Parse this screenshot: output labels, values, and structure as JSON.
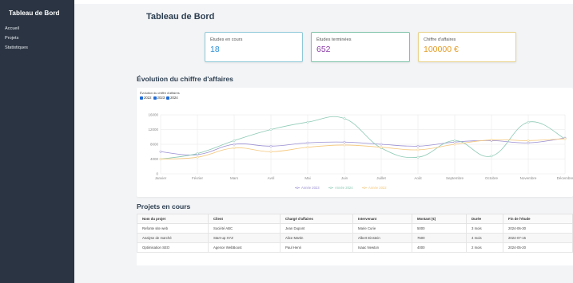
{
  "sidebar": {
    "title": "Tableau de Bord",
    "items": [
      {
        "label": "Accueil"
      },
      {
        "label": "Projets"
      },
      {
        "label": "Statistiques"
      }
    ]
  },
  "header": {
    "title": "Tableau de Bord"
  },
  "stats": [
    {
      "label": "Études en cours",
      "value": "18",
      "color": "#2d8fd5",
      "border": "#8fc9d8"
    },
    {
      "label": "Études terminées",
      "value": "652",
      "color": "#8a3aa6",
      "border": "#7fc2a8"
    },
    {
      "label": "Chiffre d'affaires",
      "value": "100000 €",
      "color": "#e39a1f",
      "border": "#e8d28a"
    }
  ],
  "chart_section": {
    "title": "Évolution du chiffre d'affaires",
    "caption": "Évolution du chiffre d'affaires",
    "toggles": [
      "2022",
      "2023",
      "2024"
    ]
  },
  "chart_data": {
    "type": "line",
    "categories": [
      "Janvier",
      "Février",
      "Mars",
      "Avril",
      "Mai",
      "Juin",
      "Juillet",
      "Août",
      "Septembre",
      "Octobre",
      "Novembre",
      "Décembre"
    ],
    "ylim": [
      0,
      16000
    ],
    "yticks": [
      0,
      4000,
      8000,
      12000,
      16000
    ],
    "grid": true,
    "legend_position": "bottom",
    "series": [
      {
        "name": "Année 2023",
        "color": "#9b8fd3",
        "values": [
          6000,
          5200,
          8000,
          7500,
          8400,
          8600,
          8000,
          7500,
          8600,
          9000,
          8400,
          9700
        ]
      },
      {
        "name": "Année 2024",
        "color": "#8cc9b5",
        "values": [
          4000,
          5500,
          9000,
          12000,
          14000,
          15000,
          7000,
          4500,
          9000,
          4800,
          14000,
          9500
        ]
      },
      {
        "name": "Année 2022",
        "color": "#f4c77a",
        "values": [
          4000,
          4500,
          7000,
          6000,
          7200,
          7800,
          7200,
          6500,
          8000,
          9200,
          9000,
          9500
        ]
      }
    ]
  },
  "projects": {
    "title": "Projets en cours",
    "columns": [
      "Nom du projet",
      "Client",
      "Chargé d'affaires",
      "Intervenant",
      "Montant (€)",
      "Durée",
      "Fin de l'étude"
    ],
    "rows": [
      [
        "Refonte site web",
        "Société ABC",
        "Jean Dupont",
        "Marie Curie",
        "5000",
        "3 mois",
        "2024-06-30"
      ],
      [
        "Analyse de marché",
        "Start-up XYZ",
        "Alice Martin",
        "Albert Einstein",
        "7500",
        "4 mois",
        "2024-07-15"
      ],
      [
        "Optimisation SEO",
        "Agence WebBoost",
        "Paul Henri",
        "Isaac Newton",
        "4000",
        "2 mois",
        "2024-05-20"
      ]
    ]
  }
}
